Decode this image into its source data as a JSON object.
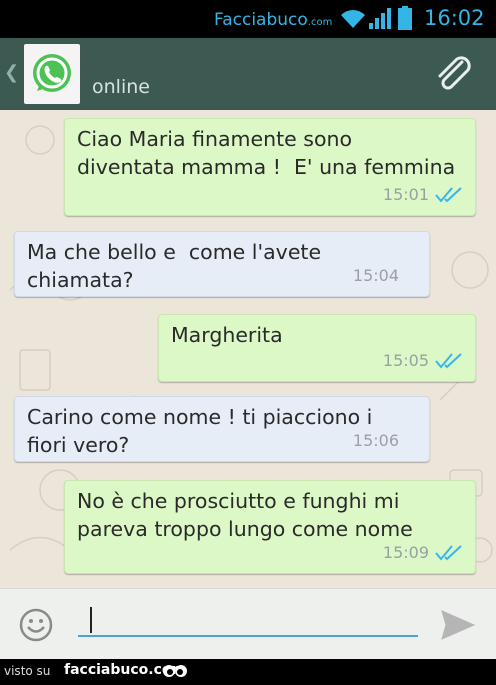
{
  "statusbar": {
    "brand": "Facciabuco",
    "brand_suffix": ".com",
    "time": "16:02"
  },
  "header": {
    "contact_status": "online",
    "avatar_icon": "whatsapp-logo-icon",
    "attach_icon": "paperclip-icon",
    "back_icon": "chevron-left-icon"
  },
  "messages": [
    {
      "direction": "out",
      "text": "Ciao Maria finamente sono\ndiventata mamma !  E' una femmina",
      "time": "15:01",
      "read": true
    },
    {
      "direction": "in",
      "text": "Ma che bello e  come l'avete\nchiamata?",
      "time": "15:04"
    },
    {
      "direction": "out",
      "text": "Margherita",
      "time": "15:05",
      "read": true
    },
    {
      "direction": "in",
      "text": "Carino come nome ! ti piacciono i\nfiori vero?",
      "time": "15:06"
    },
    {
      "direction": "out",
      "text": "No è che prosciutto e funghi mi\npareva troppo lungo come nome",
      "time": "15:09",
      "read": true
    }
  ],
  "input": {
    "value": "",
    "emoji_icon": "smiley-icon",
    "send_icon": "send-arrow-icon"
  },
  "footer": {
    "visto": "visto su",
    "site": "facciabuco.com"
  },
  "colors": {
    "header": "#3d5a52",
    "outgoing_bubble": "#dcf8c6",
    "incoming_bubble": "#e6edf7",
    "read_tick": "#34b7f1",
    "status_accent": "#33b5e5"
  }
}
